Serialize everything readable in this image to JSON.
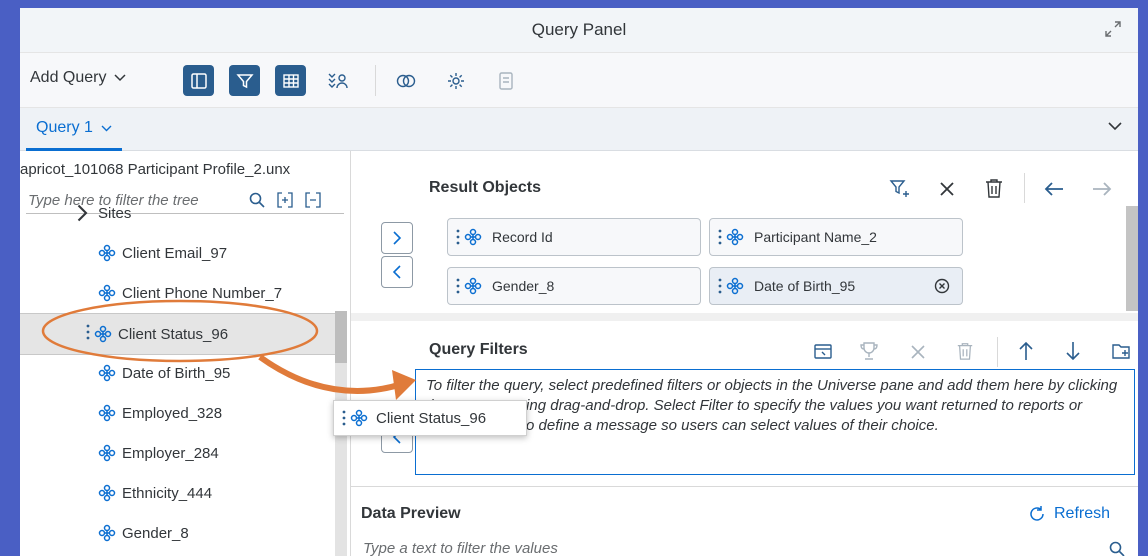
{
  "window": {
    "title": "Query Panel"
  },
  "toolbar": {
    "add_query": "Add Query"
  },
  "tabs": {
    "active": "Query 1"
  },
  "left": {
    "universe": "apricot_101068 Participant Profile_2.unx",
    "filter_placeholder": "Type here to filter the tree",
    "partial_item": "Sites",
    "items": [
      {
        "label": "Client Email_97"
      },
      {
        "label": "Client Phone Number_7"
      },
      {
        "label": "Client Status_96"
      },
      {
        "label": "Date of Birth_95"
      },
      {
        "label": "Employed_328"
      },
      {
        "label": "Employer_284"
      },
      {
        "label": "Ethnicity_444"
      },
      {
        "label": "Gender_8"
      }
    ]
  },
  "result": {
    "title": "Result Objects",
    "objects": [
      {
        "label": "Record Id"
      },
      {
        "label": "Participant Name_2"
      },
      {
        "label": "Gender_8"
      },
      {
        "label": "Date of Birth_95"
      }
    ]
  },
  "filters": {
    "title": "Query Filters",
    "placeholder": "To filter the query, select predefined filters or objects in the Universe pane and add them here by clicking the arrow or using drag-and-drop. Select Filter to specify the values you want returned to reports or select Prompt to define a message so users can select values of their choice."
  },
  "drag": {
    "label": "Client Status_96"
  },
  "preview": {
    "title": "Data Preview",
    "refresh": "Refresh",
    "filter_placeholder": "Type a text to filter the values"
  },
  "colors": {
    "accent": "#0a6ed1",
    "active_button": "#2a5d8e",
    "highlight": "#e07b3a"
  }
}
